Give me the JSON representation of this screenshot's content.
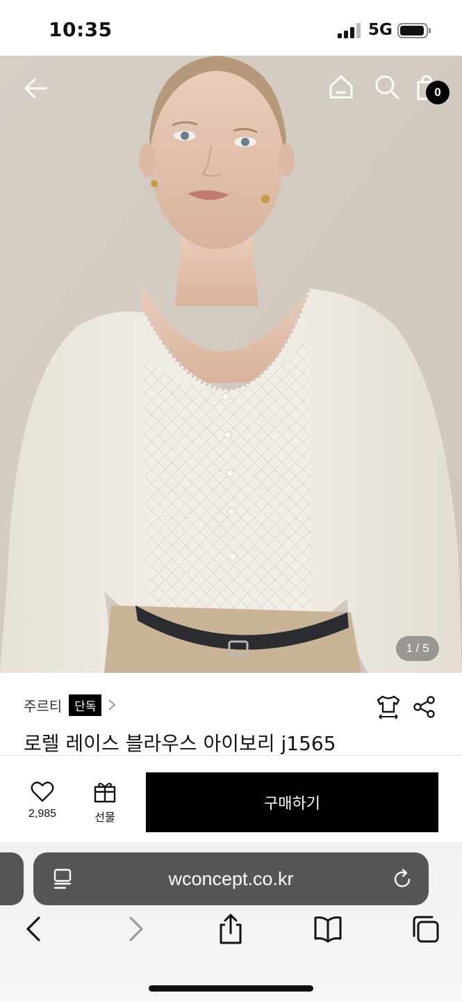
{
  "status_bar": {
    "time": "10:35",
    "network": "5G",
    "signal_icon": "signal-bars-icon",
    "battery_icon": "battery-icon"
  },
  "hero": {
    "image_description_icon": "product-photo",
    "page_indicator": "1 / 5",
    "cart_count": "0",
    "icons": [
      "back-arrow-icon",
      "home-icon",
      "search-icon",
      "shopping-bag-icon"
    ]
  },
  "product": {
    "brand": "주르티",
    "badge": "단독",
    "title": "로렐 레이스 블라우스 아이보리 j1565",
    "icons": [
      "size-guide-icon",
      "share-icon"
    ]
  },
  "actions": {
    "like_count": "2,985",
    "gift_label": "선물",
    "buy_label": "구매하기",
    "icons": [
      "heart-icon",
      "gift-icon"
    ]
  },
  "browser": {
    "url": "wconcept.co.kr",
    "icons": [
      "reader-icon",
      "reload-icon",
      "back-icon",
      "forward-icon",
      "share-icon",
      "bookmarks-icon",
      "tabs-icon"
    ]
  },
  "colors": {
    "accent": "#000000",
    "wall": "#d8d1c8",
    "blouse": "#f1ede4",
    "pants": "#c9b497",
    "address_bar": "#565656"
  }
}
